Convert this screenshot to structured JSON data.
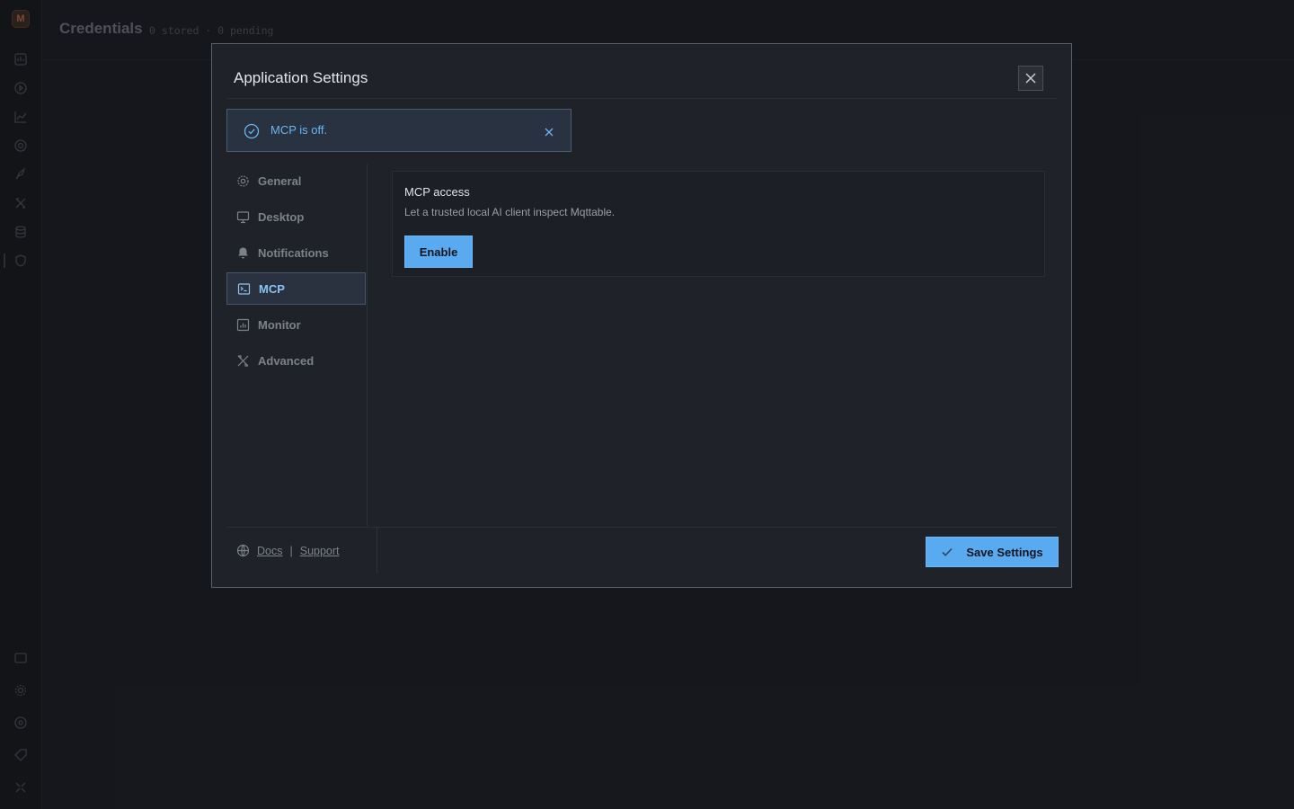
{
  "app": {
    "logo_letter": "M",
    "page_title": "Credentials",
    "page_subtitle": "0 stored · 0 pending",
    "rail_icons_top": [
      "dashboard-icon",
      "play-icon",
      "chart-icon",
      "target-icon",
      "rocket-icon",
      "tools-icon",
      "database-icon",
      "shield-icon"
    ],
    "rail_icons_bottom": [
      "terminal-icon",
      "gear-icon",
      "help-icon",
      "tag-icon",
      "collapse-icon"
    ]
  },
  "modal": {
    "title": "Application Settings",
    "close_icon": "close-icon"
  },
  "toast": {
    "message": "MCP is off.",
    "icon": "check-circle-icon",
    "color": "#6cb4f0"
  },
  "nav": {
    "items": [
      {
        "label": "General",
        "icon": "gear-icon"
      },
      {
        "label": "Desktop",
        "icon": "monitor-icon"
      },
      {
        "label": "Notifications",
        "icon": "bell-icon"
      },
      {
        "label": "MCP",
        "icon": "terminal-icon",
        "active": true
      },
      {
        "label": "Monitor",
        "icon": "chart-icon"
      },
      {
        "label": "Advanced",
        "icon": "tools-icon"
      }
    ]
  },
  "mcp": {
    "title": "MCP access",
    "description": "Let a trusted local AI client inspect Mqttable.",
    "enable_label": "Enable"
  },
  "footer": {
    "docs_label": "Docs",
    "separator": "|",
    "support_label": "Support",
    "save_label": "Save Settings"
  },
  "colors": {
    "accent": "#5aaaf0",
    "modal_bg": "#1f2229",
    "page_bg": "#1b1d23"
  }
}
